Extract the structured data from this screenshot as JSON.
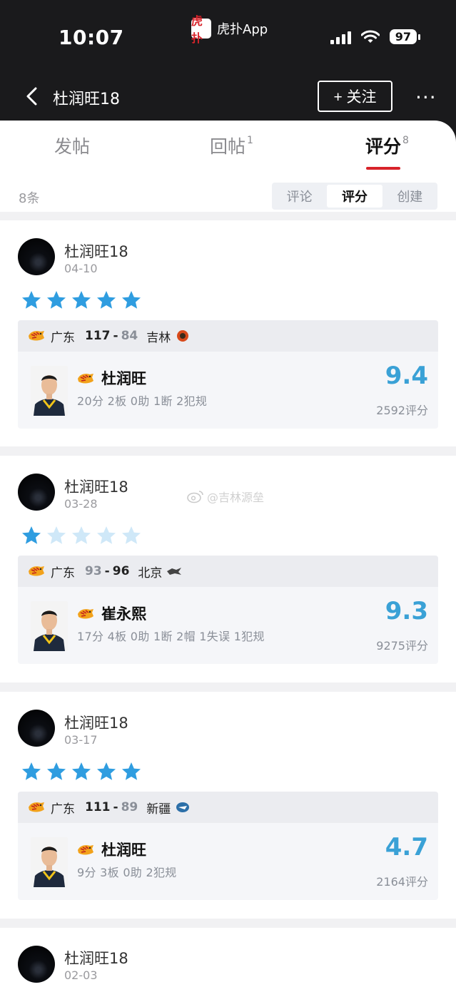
{
  "status_bar": {
    "time": "10:07",
    "app_label": "虎扑App",
    "app_logo_text": "虎扑",
    "battery": "97"
  },
  "nav": {
    "title": "杜润旺18",
    "follow_label": "+ 关注",
    "more_label": "···"
  },
  "tabs": [
    {
      "label": "发帖",
      "count": ""
    },
    {
      "label": "回帖",
      "count": "1"
    },
    {
      "label": "评分",
      "count": "8"
    }
  ],
  "list_header": {
    "count_text": "8条",
    "filters": [
      "评论",
      "评分",
      "创建"
    ],
    "active_filter": "评分"
  },
  "colors": {
    "accent_red": "#d8232a",
    "rating_blue": "#3aa1d6",
    "star_blue": "#2f9de0",
    "star_empty": "#cfe8f8"
  },
  "posts": [
    {
      "user": "杜润旺18",
      "date": "04-10",
      "stars": 5,
      "match": {
        "home": "广东",
        "home_score": "117",
        "away_score": "84",
        "away": "吉林",
        "home_won": true
      },
      "player": {
        "name": "杜润旺",
        "stats": "20分 2板 0助 1断 2犯规",
        "rating": "9.4",
        "rating_count": "2592评分"
      }
    },
    {
      "user": "杜润旺18",
      "date": "03-28",
      "stars": 1,
      "match": {
        "home": "广东",
        "home_score": "93",
        "away_score": "96",
        "away": "北京",
        "home_won": false
      },
      "player": {
        "name": "崔永熙",
        "stats": "17分 4板 0助 1断 2帽 1失误 1犯规",
        "rating": "9.3",
        "rating_count": "9275评分"
      }
    },
    {
      "user": "杜润旺18",
      "date": "03-17",
      "stars": 5,
      "match": {
        "home": "广东",
        "home_score": "111",
        "away_score": "89",
        "away": "新疆",
        "home_won": true
      },
      "player": {
        "name": "杜润旺",
        "stats": "9分 3板 0助 2犯规",
        "rating": "4.7",
        "rating_count": "2164评分"
      }
    },
    {
      "user": "杜润旺18",
      "date": "02-03"
    }
  ],
  "watermark": "@吉林源垒"
}
